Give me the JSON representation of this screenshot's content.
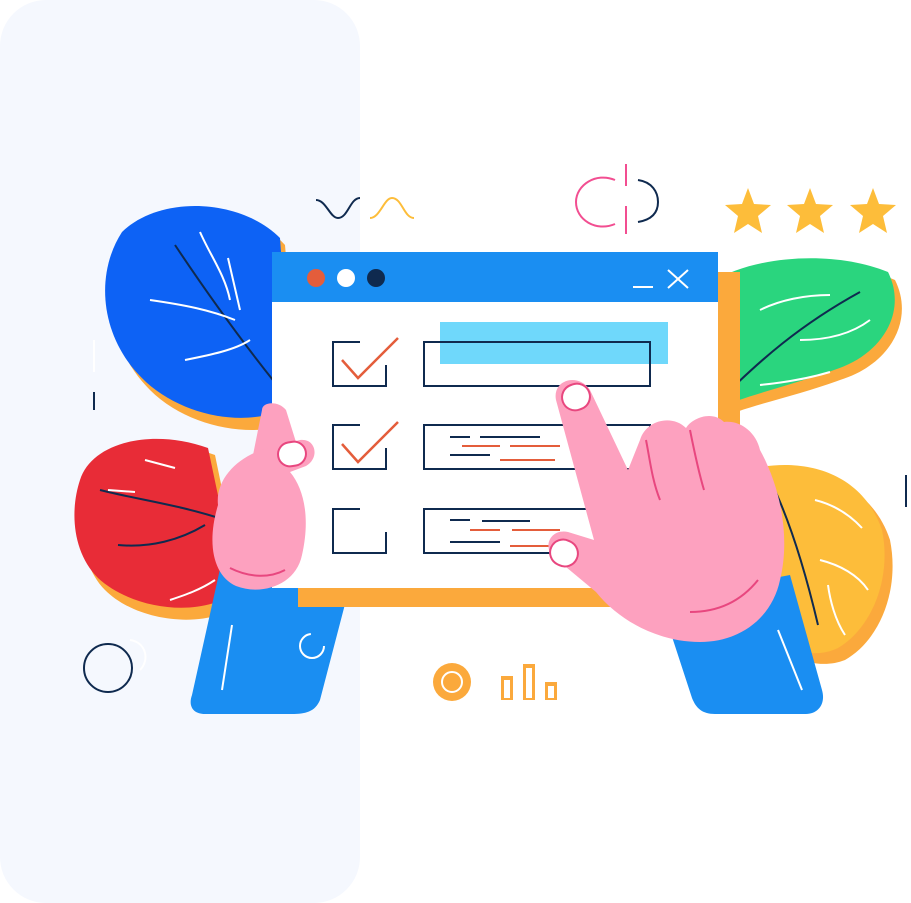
{
  "illustration": {
    "subject": "checklist-on-browser-window",
    "window_controls": [
      "close-dot",
      "minimize-dot",
      "maximize-dot",
      "minimize-icon",
      "close-icon"
    ],
    "checklist": [
      {
        "checked": true
      },
      {
        "checked": true
      },
      {
        "checked": false
      }
    ],
    "rating": {
      "value": 3,
      "max": 3
    },
    "colors": {
      "background": "#ffffff",
      "side_panel": "#f5f8fe",
      "window_bar": "#1a8ef2",
      "window_body": "#ffffff",
      "window_shadow": "#fba93c",
      "outline": "#0f2a4f",
      "check_mark": "#e45d3b",
      "highlight": "#6fd8fb",
      "skin": "#fda1bf",
      "sleeve": "#1a8ef2",
      "leaf_blue": "#0d62f5",
      "leaf_red": "#e82c37",
      "leaf_green": "#2ad57e",
      "leaf_yellow": "#fdbd3a",
      "leaf_shadow": "#fba93c",
      "star": "#fdbd3a",
      "accent_pink": "#f24e91"
    }
  }
}
